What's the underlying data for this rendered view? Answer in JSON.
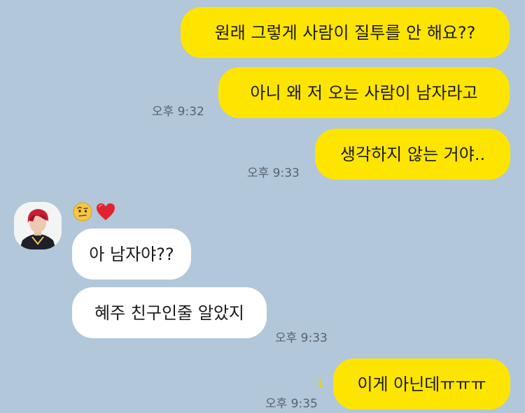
{
  "messages": {
    "m1": {
      "text": "원래 그렇게 사람이 질투를 안 해요??"
    },
    "m2": {
      "text": "아니 왜 저 오는 사람이 남자라고",
      "time": "오후 9:32"
    },
    "m3": {
      "text": "생각하지 않는 거야..",
      "time": "오후 9:33"
    },
    "r1": {
      "text": "아 남자야??"
    },
    "r2": {
      "text": "혜주 친구인줄 알았지",
      "time": "오후 9:33"
    },
    "m4": {
      "text": "이게 아닌데ㅠㅠㅠ",
      "time": "오후 9:35",
      "unread": "1"
    }
  },
  "reactions": [
    "raised-eyebrow-face-icon",
    "red-heart-icon"
  ],
  "colors": {
    "background": "#b2c7d9",
    "my_bubble": "#fee500",
    "their_bubble": "#ffffff",
    "unread": "#e5d300"
  }
}
